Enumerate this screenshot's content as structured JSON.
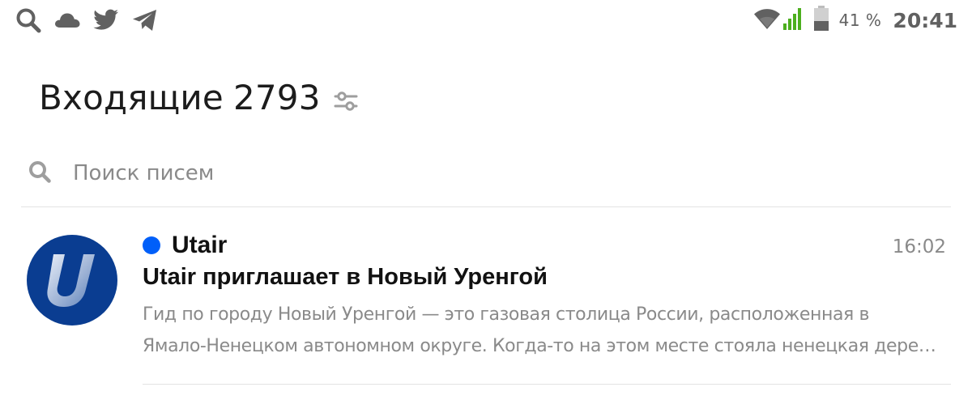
{
  "status_bar": {
    "left_icons": [
      "search-icon",
      "cloud-icon",
      "twitter-icon",
      "telegram-icon"
    ],
    "right_icons": [
      "wifi-icon",
      "cellular-signal-icon",
      "battery-icon"
    ],
    "battery_percent": "41 %",
    "battery_level": 0.41,
    "time": "20:41",
    "icon_color": "#616161",
    "signal_color": "#4caf1e"
  },
  "header": {
    "title": "Входящие",
    "count": "2793",
    "filter_icon": "sliders-icon"
  },
  "search": {
    "placeholder": "Поиск писем",
    "value": "",
    "icon": "search-icon"
  },
  "messages": [
    {
      "sender": "Utair",
      "unread": true,
      "unread_color": "#005ff9",
      "time": "16:02",
      "subject": "Utair приглашает в Новый Уренгой",
      "snippet_line1": "Гид по городу Новый Уренгой — это газовая столица России, расположенная в",
      "snippet_line2": "Ямало-Ненецком автономном округе. Когда-то на этом месте стояла ненецкая дере…",
      "avatar": "utair-logo-icon",
      "avatar_color": "#0a3d91"
    }
  ]
}
